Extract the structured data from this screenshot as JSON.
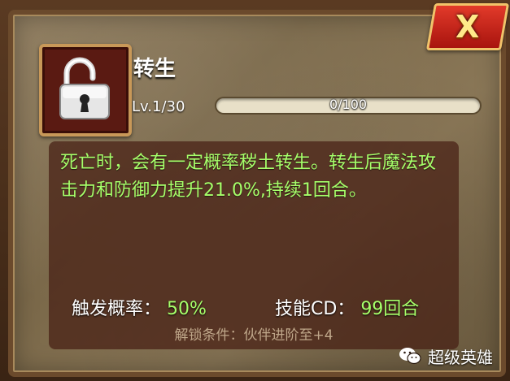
{
  "window": {
    "close_label": "X"
  },
  "skill": {
    "name": "转生",
    "icon": "padlock-icon",
    "level_text": "Lv.1/30",
    "xp_text": "0/100",
    "xp_fraction": 0.0
  },
  "description": {
    "text": "死亡时，会有一定概率秽土转生。转生后魔法攻击力和防御力提升21.0%,持续1回合。"
  },
  "stats": {
    "trigger_label": "触发概率：",
    "trigger_value": "50%",
    "cd_label": "技能CD：",
    "cd_value": "99回合"
  },
  "unlock": {
    "text": "解锁条件：伙伴进阶至+4"
  },
  "watermark": {
    "text": "超级英雄",
    "logo": "wechat-logo-icon"
  },
  "colors": {
    "accent_green": "#a6ff6a",
    "close_red": "#d32a1e",
    "frame_gold": "#c89858"
  }
}
